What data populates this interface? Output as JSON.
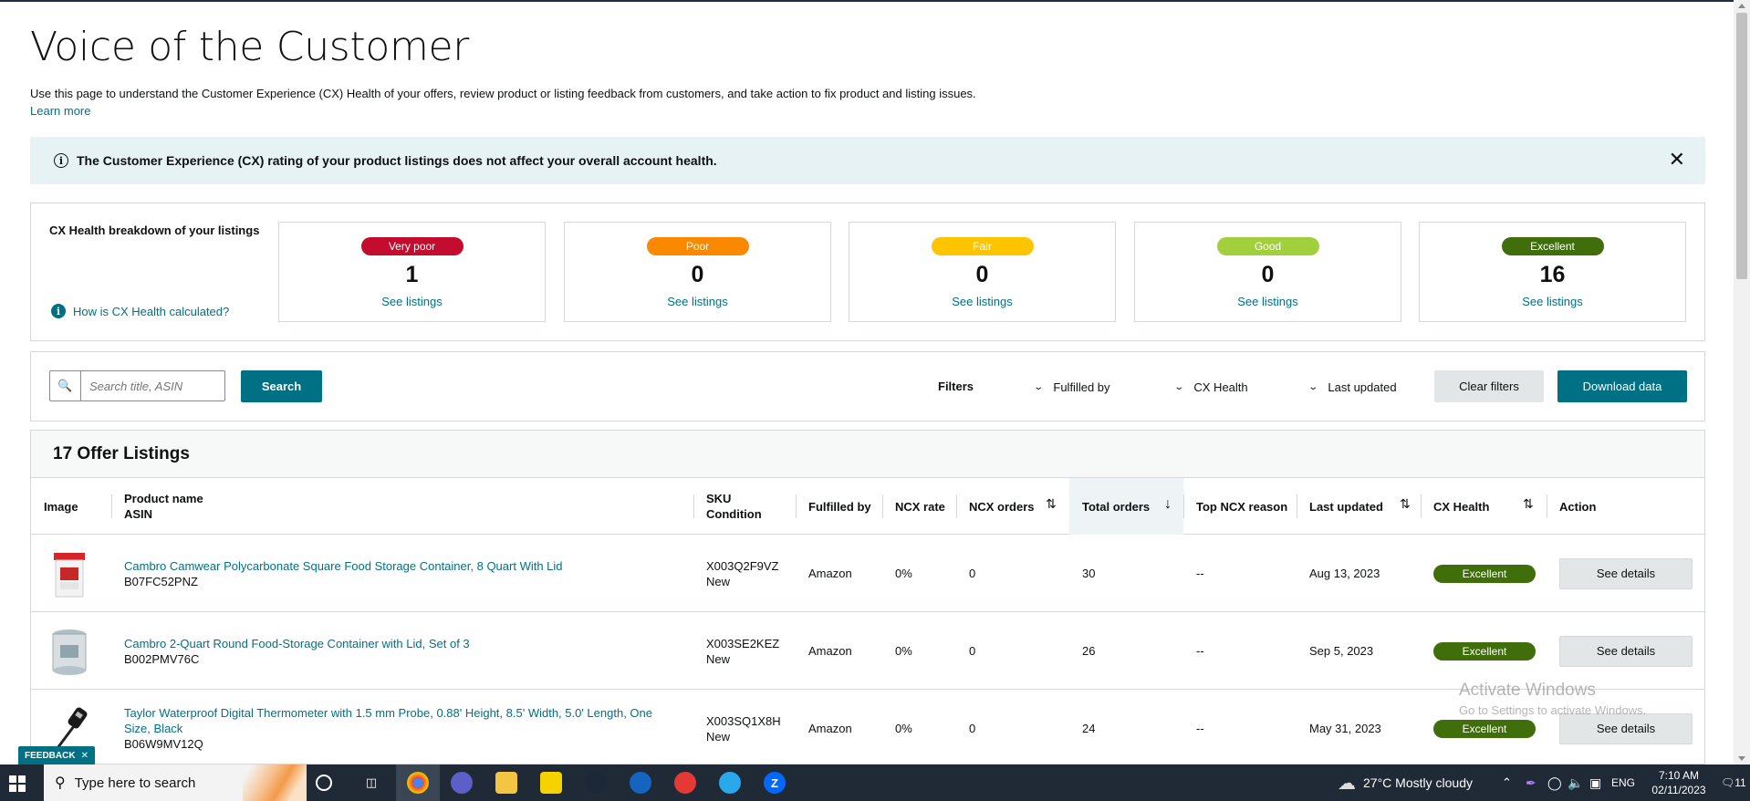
{
  "header": {
    "title": "Voice of the Customer",
    "description": "Use this page to understand the Customer Experience (CX) Health of your offers, review product or listing feedback from customers, and take action to fix product and listing issues.",
    "learn_more": "Learn more"
  },
  "banner": {
    "message": "The Customer Experience (CX) rating of your product listings does not affect your overall account health.",
    "close": "✕"
  },
  "health": {
    "label": "CX Health breakdown of your listings",
    "how_link": "How is CX Health calculated?",
    "cards": [
      {
        "label": "Very poor",
        "count": "1",
        "link": "See listings",
        "color": "#c40c2e"
      },
      {
        "label": "Poor",
        "count": "0",
        "link": "See listings",
        "color": "#fa8900"
      },
      {
        "label": "Fair",
        "count": "0",
        "link": "See listings",
        "color": "#ffc400"
      },
      {
        "label": "Good",
        "count": "0",
        "link": "See listings",
        "color": "#a2cf3c"
      },
      {
        "label": "Excellent",
        "count": "16",
        "link": "See listings",
        "color": "#3f6e0a"
      }
    ]
  },
  "filters": {
    "search_placeholder": "Search title, ASIN",
    "search_button": "Search",
    "filters_label": "Filters",
    "fulfilled_by": "Fulfilled by",
    "cx_health": "CX Health",
    "last_updated": "Last updated",
    "clear": "Clear filters",
    "download": "Download data"
  },
  "listings": {
    "title": "17 Offer Listings",
    "columns": {
      "image": "Image",
      "product_name": "Product name",
      "asin": "ASIN",
      "sku": "SKU",
      "condition": "Condition",
      "fulfilled_by": "Fulfilled by",
      "ncx_rate": "NCX rate",
      "ncx_orders": "NCX orders",
      "total_orders": "Total orders",
      "top_ncx_reason": "Top NCX reason",
      "last_updated": "Last updated",
      "cx_health": "CX Health",
      "action": "Action"
    },
    "rows": [
      {
        "name": "Cambro Camwear Polycarbonate Square Food Storage Container, 8 Quart With Lid",
        "asin": "B07FC52PNZ",
        "sku": "X003Q2F9VZ",
        "condition": "New",
        "fulfilled_by": "Amazon",
        "ncx_rate": "0%",
        "ncx_orders": "0",
        "total_orders": "30",
        "top_reason": "--",
        "last_updated": "Aug 13, 2023",
        "health": "Excellent",
        "action": "See details",
        "image": "red-lid-container"
      },
      {
        "name": "Cambro 2-Quart Round Food-Storage Container with Lid, Set of 3",
        "asin": "B002PMV76C",
        "sku": "X003SE2KEZ",
        "condition": "New",
        "fulfilled_by": "Amazon",
        "ncx_rate": "0%",
        "ncx_orders": "0",
        "total_orders": "26",
        "top_reason": "--",
        "last_updated": "Sep 5, 2023",
        "health": "Excellent",
        "action": "See details",
        "image": "round-container"
      },
      {
        "name": "Taylor Waterproof Digital Thermometer with 1.5 mm Probe, 0.88' Height, 8.5' Width, 5.0' Length, One Size, Black",
        "asin": "B06W9MV12Q",
        "sku": "X003SQ1X8H",
        "condition": "New",
        "fulfilled_by": "Amazon",
        "ncx_rate": "0%",
        "ncx_orders": "0",
        "total_orders": "24",
        "top_reason": "--",
        "last_updated": "May 31, 2023",
        "health": "Excellent",
        "action": "See details",
        "image": "thermometer"
      }
    ]
  },
  "feedback": "FEEDBACK",
  "feedback_close": "✕",
  "watermark": {
    "line1": "Activate Windows",
    "line2": "Go to Settings to activate Windows."
  },
  "taskbar": {
    "search_placeholder": "Type here to search",
    "weather": "27°C  Mostly cloudy",
    "language": "ENG",
    "time": "7:10 AM",
    "date": "02/11/2023",
    "notifications": "11"
  }
}
